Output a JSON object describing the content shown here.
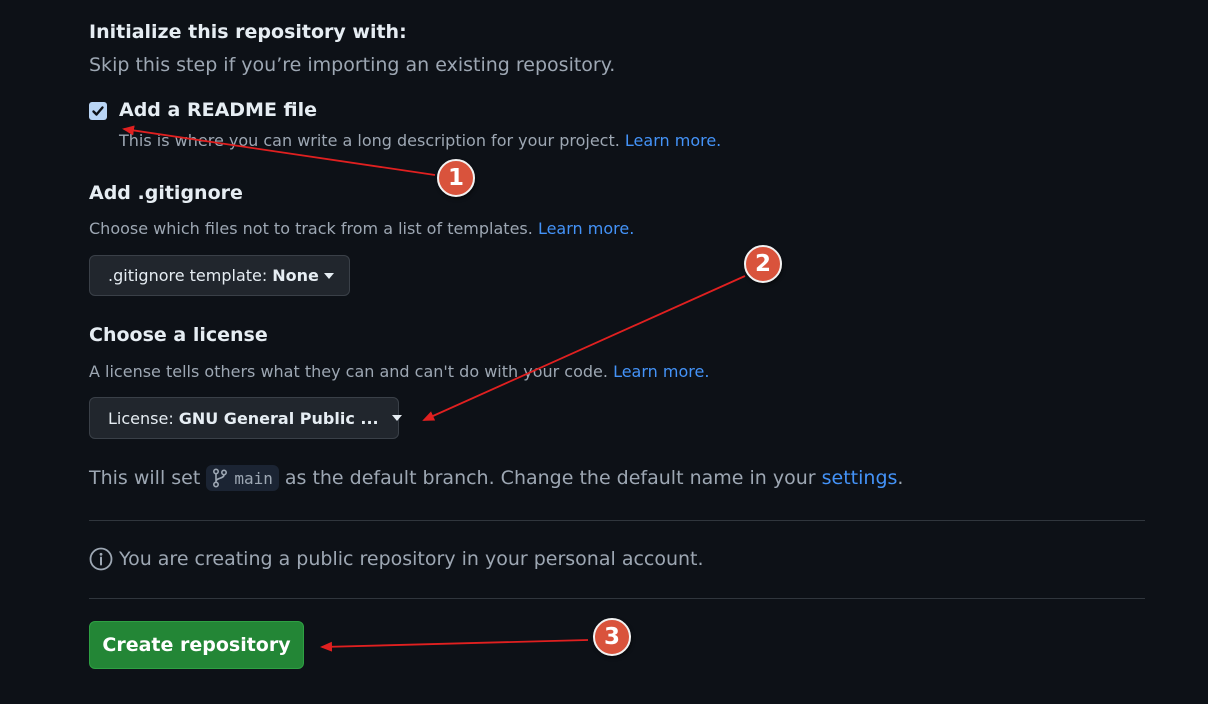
{
  "init": {
    "heading": "Initialize this repository with:",
    "subtext": "Skip this step if you’re importing an existing repository."
  },
  "readme": {
    "checked": true,
    "label": "Add a README file",
    "description": "This is where you can write a long description for your project.",
    "learn_more": "Learn more."
  },
  "gitignore": {
    "heading": "Add .gitignore",
    "description": "Choose which files not to track from a list of templates.",
    "learn_more": "Learn more.",
    "select_prefix": ".gitignore template:",
    "select_value": "None"
  },
  "license": {
    "heading": "Choose a license",
    "description": "A license tells others what they can and can't do with your code.",
    "learn_more": "Learn more.",
    "select_prefix": "License:",
    "select_value": "GNU General Public ..."
  },
  "branch": {
    "prefix": "This will set",
    "name": "main",
    "middle": "as the default branch. Change the default name in your",
    "settings_link": "settings",
    "suffix": "."
  },
  "info": {
    "text": "You are creating a public repository in your personal account."
  },
  "create_button": {
    "label": "Create repository"
  },
  "annotations": {
    "badge_1": "1",
    "badge_2": "2",
    "badge_3": "3",
    "arrow_color": "#e02020",
    "badge_color": "#d9533c"
  },
  "icons": {
    "checkbox": "check-icon",
    "branch": "git-branch-icon",
    "info": "info-icon",
    "caret": "caret-down-icon"
  }
}
